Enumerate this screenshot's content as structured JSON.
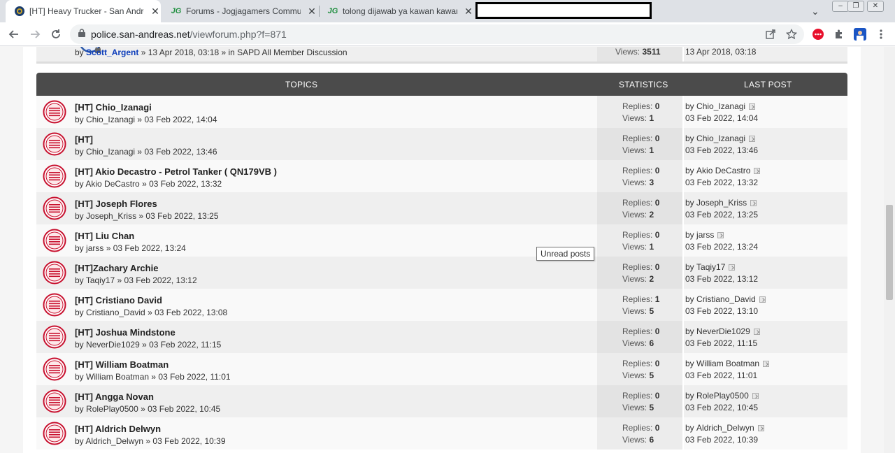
{
  "browser": {
    "tabs": [
      {
        "title": "[HT] Heavy Trucker - San Andreas",
        "active": true
      },
      {
        "title": "Forums - Jogjagamers Community",
        "active": false
      },
      {
        "title": "tolong dijawab ya kawan kawan - J",
        "active": false
      }
    ],
    "favicon_text": "JG",
    "url_host": "police.san-andreas.net",
    "url_path": "/viewforum.php?f=871"
  },
  "previous_row": {
    "by": "by",
    "author": "Scott_Argent",
    "meta": " » 13 Apr 2018, 03:18 » in SAPD All Member Discussion",
    "views_label": "Views:",
    "views": "3511",
    "last_post_date": "13 Apr 2018, 03:18"
  },
  "header": {
    "topics": "TOPICS",
    "statistics": "STATISTICS",
    "last_post": "LAST POST"
  },
  "labels": {
    "replies": "Replies:",
    "views": "Views:",
    "by": "by"
  },
  "tooltip": "Unread posts",
  "topics": [
    {
      "title": "[HT] Chio_Izanagi",
      "author": "Chio_Izanagi",
      "date": "03 Feb 2022, 14:04",
      "replies": "0",
      "views": "1",
      "last_by": "Chio_Izanagi",
      "last_date": "03 Feb 2022, 14:04"
    },
    {
      "title": "[HT]",
      "author": "Chio_Izanagi",
      "date": "03 Feb 2022, 13:46",
      "replies": "0",
      "views": "1",
      "last_by": "Chio_Izanagi",
      "last_date": "03 Feb 2022, 13:46"
    },
    {
      "title": "[HT] Akio Decastro - Petrol Tanker ( QN179VB )",
      "author": "Akio DeCastro",
      "date": "03 Feb 2022, 13:32",
      "replies": "0",
      "views": "3",
      "last_by": "Akio DeCastro",
      "last_date": "03 Feb 2022, 13:32"
    },
    {
      "title": "[HT] Joseph Flores",
      "author": "Joseph_Kriss",
      "date": "03 Feb 2022, 13:25",
      "replies": "0",
      "views": "2",
      "last_by": "Joseph_Kriss",
      "last_date": "03 Feb 2022, 13:25"
    },
    {
      "title": "[HT] Liu Chan",
      "author": "jarss",
      "date": "03 Feb 2022, 13:24",
      "replies": "0",
      "views": "1",
      "last_by": "jarss",
      "last_date": "03 Feb 2022, 13:24"
    },
    {
      "title": "[HT]Zachary Archie",
      "author": "Taqiy17",
      "date": "03 Feb 2022, 13:12",
      "replies": "0",
      "views": "2",
      "last_by": "Taqiy17",
      "last_date": "03 Feb 2022, 13:12"
    },
    {
      "title": "[HT] Cristiano David",
      "author": "Cristiano_David",
      "date": "03 Feb 2022, 13:08",
      "replies": "1",
      "views": "5",
      "last_by": "Cristiano_David",
      "last_date": "03 Feb 2022, 13:10"
    },
    {
      "title": "[HT] Joshua Mindstone",
      "author": "NeverDie1029",
      "date": "03 Feb 2022, 11:15",
      "replies": "0",
      "views": "6",
      "last_by": "NeverDie1029",
      "last_date": "03 Feb 2022, 11:15"
    },
    {
      "title": "[HT] William Boatman",
      "author": "William Boatman",
      "date": "03 Feb 2022, 11:01",
      "replies": "0",
      "views": "5",
      "last_by": "William Boatman",
      "last_date": "03 Feb 2022, 11:01"
    },
    {
      "title": "[HT] Angga Novan",
      "author": "RolePlay0500",
      "date": "03 Feb 2022, 10:45",
      "replies": "0",
      "views": "5",
      "last_by": "RolePlay0500",
      "last_date": "03 Feb 2022, 10:45"
    },
    {
      "title": "[HT] Aldrich Delwyn",
      "author": "Aldrich_Delwyn",
      "date": "03 Feb 2022, 10:39",
      "replies": "0",
      "views": "6",
      "last_by": "Aldrich_Delwyn",
      "last_date": "03 Feb 2022, 10:39"
    }
  ],
  "colors": {
    "header_bg": "#4b4b4b",
    "topic_icon_red": "#c8102e",
    "author_link": "#0f3fbb"
  }
}
